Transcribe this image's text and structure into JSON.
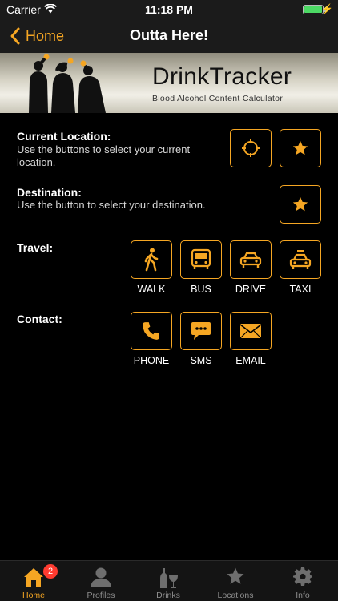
{
  "status_bar": {
    "carrier": "Carrier",
    "time": "11:18 PM"
  },
  "nav": {
    "back_label": "Home",
    "title": "Outta Here!"
  },
  "banner": {
    "title": "DrinkTracker",
    "subtitle": "Blood Alcohol Content Calculator"
  },
  "current_location": {
    "label": "Current Location:",
    "description": "Use the buttons to select your current location."
  },
  "destination": {
    "label": "Destination:",
    "description": "Use the button to select your destination."
  },
  "travel": {
    "label": "Travel:",
    "options": [
      "WALK",
      "BUS",
      "DRIVE",
      "TAXI"
    ]
  },
  "contact": {
    "label": "Contact:",
    "options": [
      "PHONE",
      "SMS",
      "EMAIL"
    ]
  },
  "tabs": [
    {
      "label": "Home",
      "icon": "home-icon",
      "badge": "2",
      "active": true
    },
    {
      "label": "Profiles",
      "icon": "profile-icon"
    },
    {
      "label": "Drinks",
      "icon": "drinks-icon"
    },
    {
      "label": "Locations",
      "icon": "star-icon"
    },
    {
      "label": "Info",
      "icon": "gear-icon"
    }
  ],
  "colors": {
    "accent": "#f5a623",
    "background": "#000000",
    "bars": "#1b1b1b",
    "badge": "#ff3b30"
  }
}
